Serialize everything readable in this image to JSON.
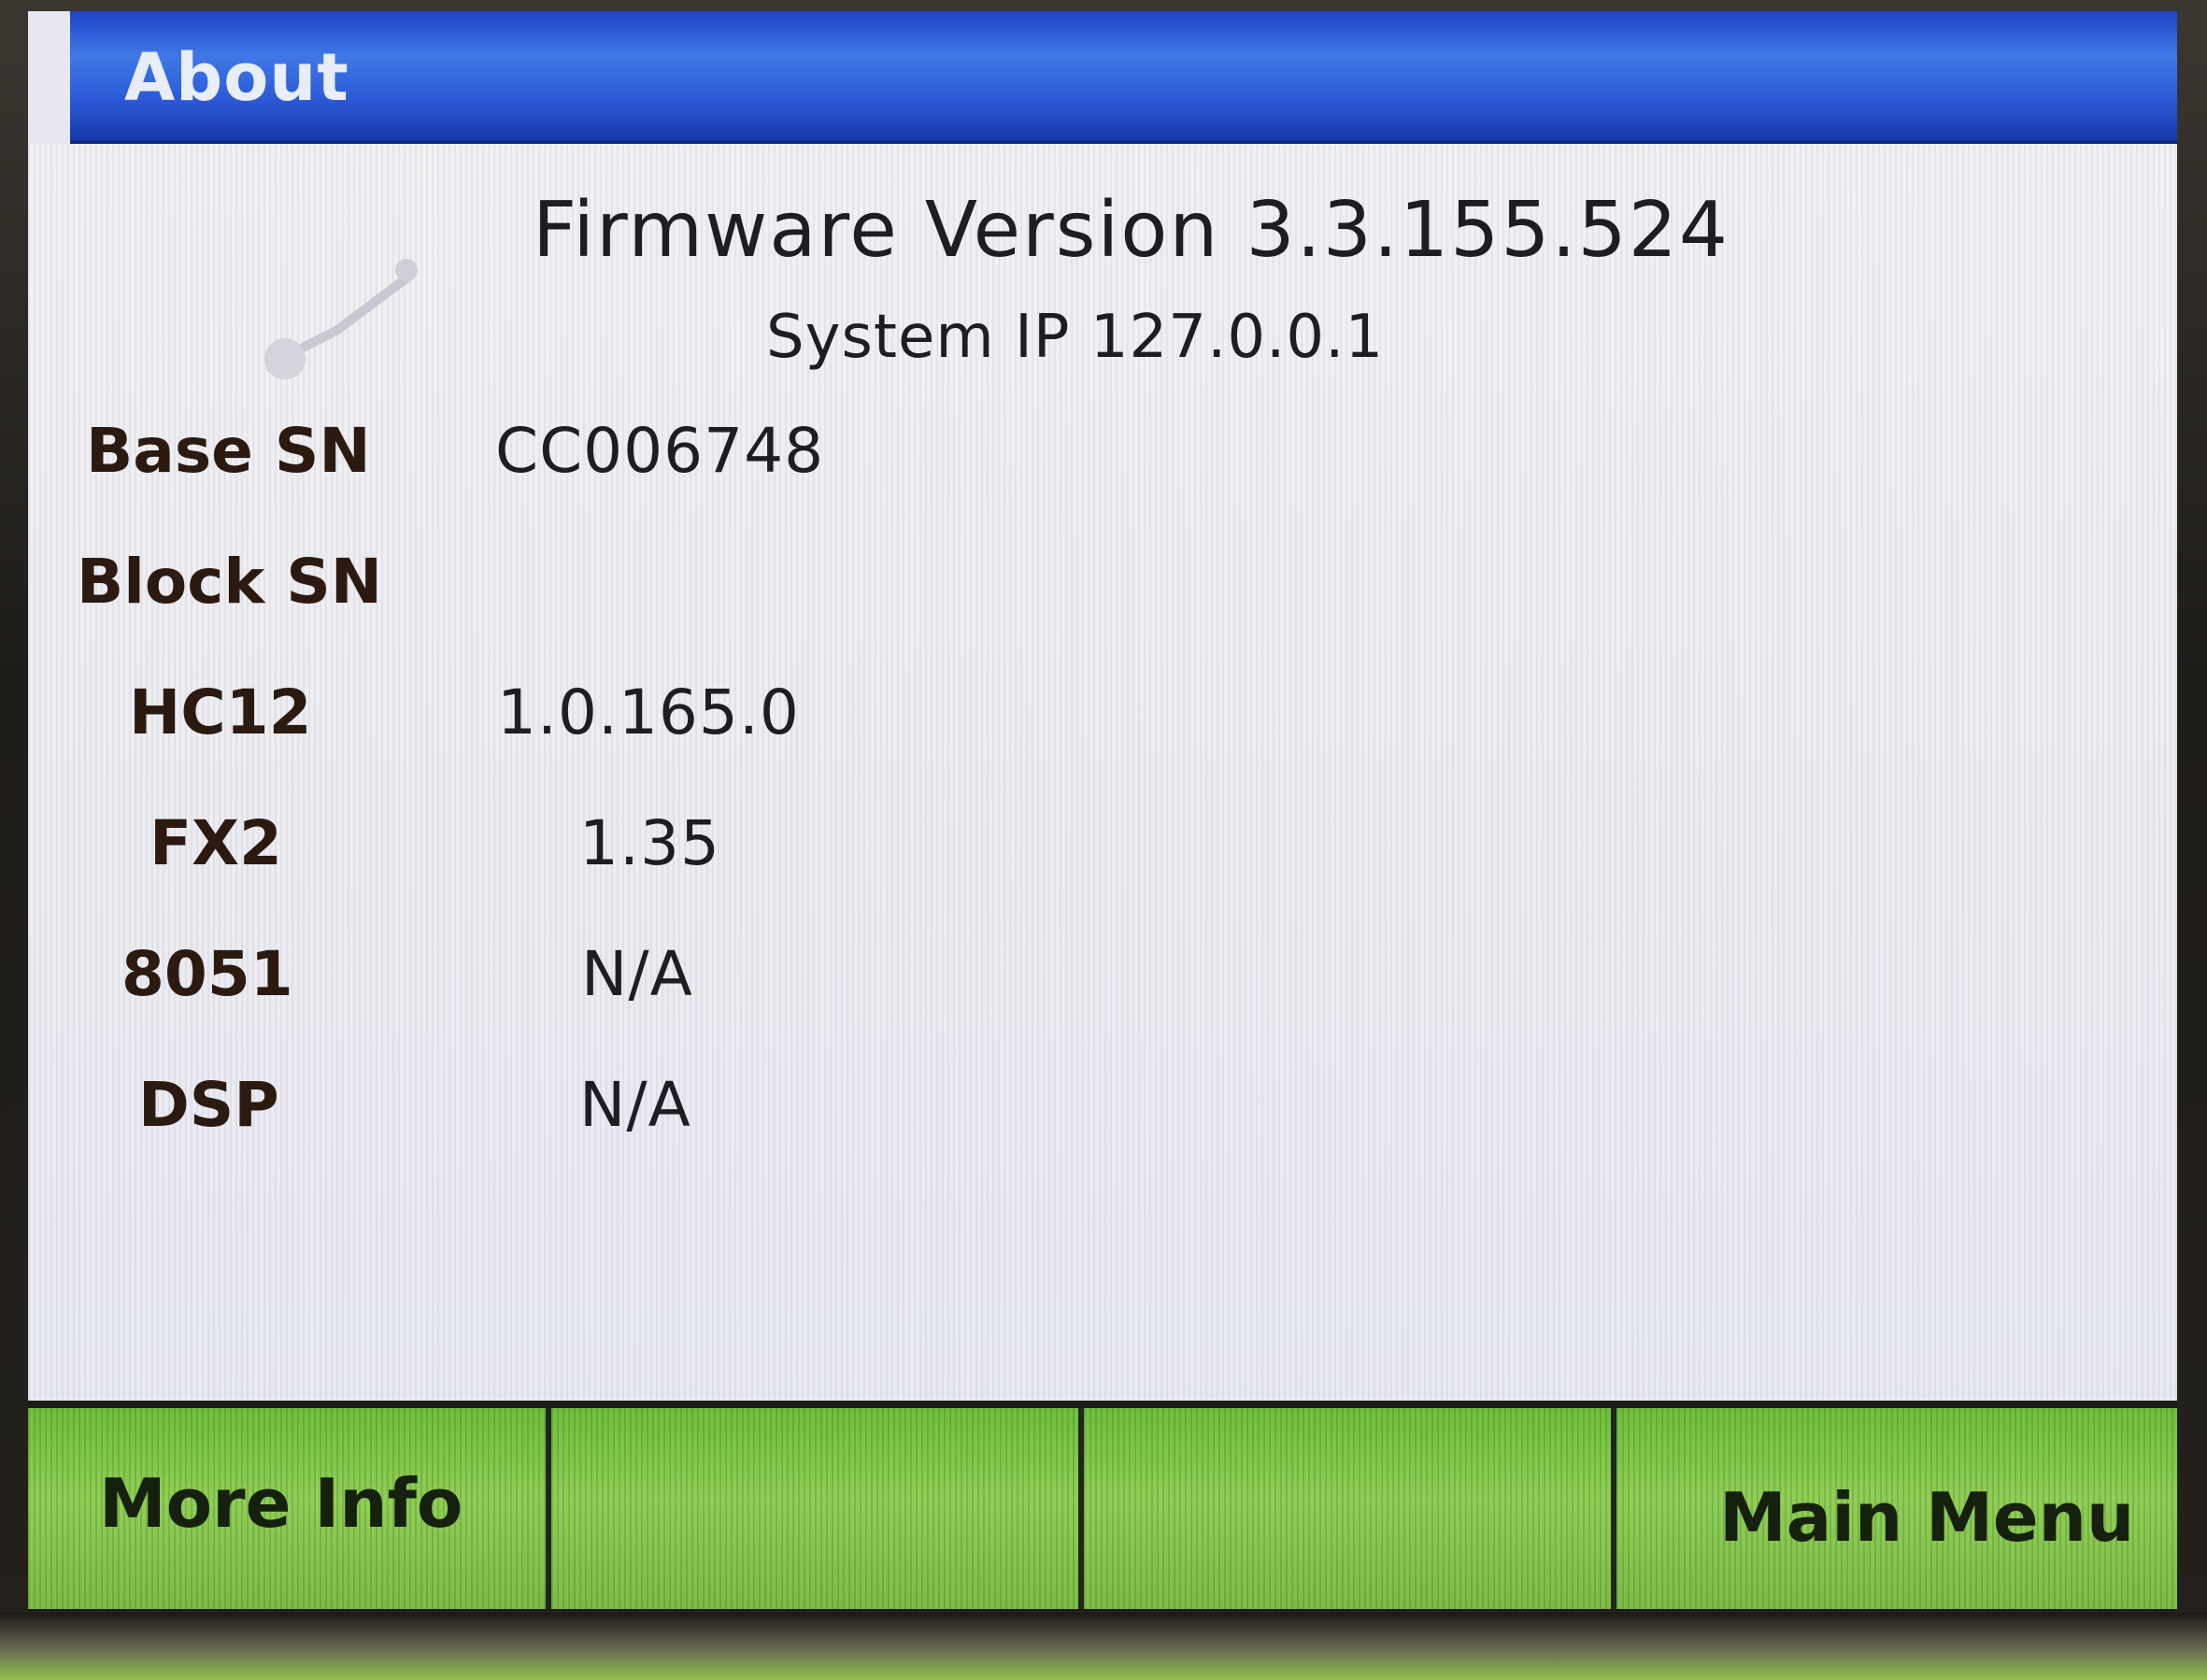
{
  "window": {
    "title": "About"
  },
  "header": {
    "firmware_version": "Firmware Version 3.3.155.524",
    "system_ip": "System IP 127.0.0.1"
  },
  "info_rows": [
    {
      "label": "Base SN",
      "value": "CC006748"
    },
    {
      "label": "Block SN",
      "value": ""
    },
    {
      "label": "HC12",
      "value": "1.0.165.0"
    },
    {
      "label": "FX2",
      "value": "1.35"
    },
    {
      "label": "8051",
      "value": "N/A"
    },
    {
      "label": "DSP",
      "value": "N/A"
    }
  ],
  "softkeys": [
    {
      "label": "More Info"
    },
    {
      "label": ""
    },
    {
      "label": ""
    },
    {
      "label": "Main Menu"
    }
  ],
  "colors": {
    "titlebar": "#2b58d6",
    "softkey": "#7dbd46",
    "background": "#e8e9f1"
  }
}
